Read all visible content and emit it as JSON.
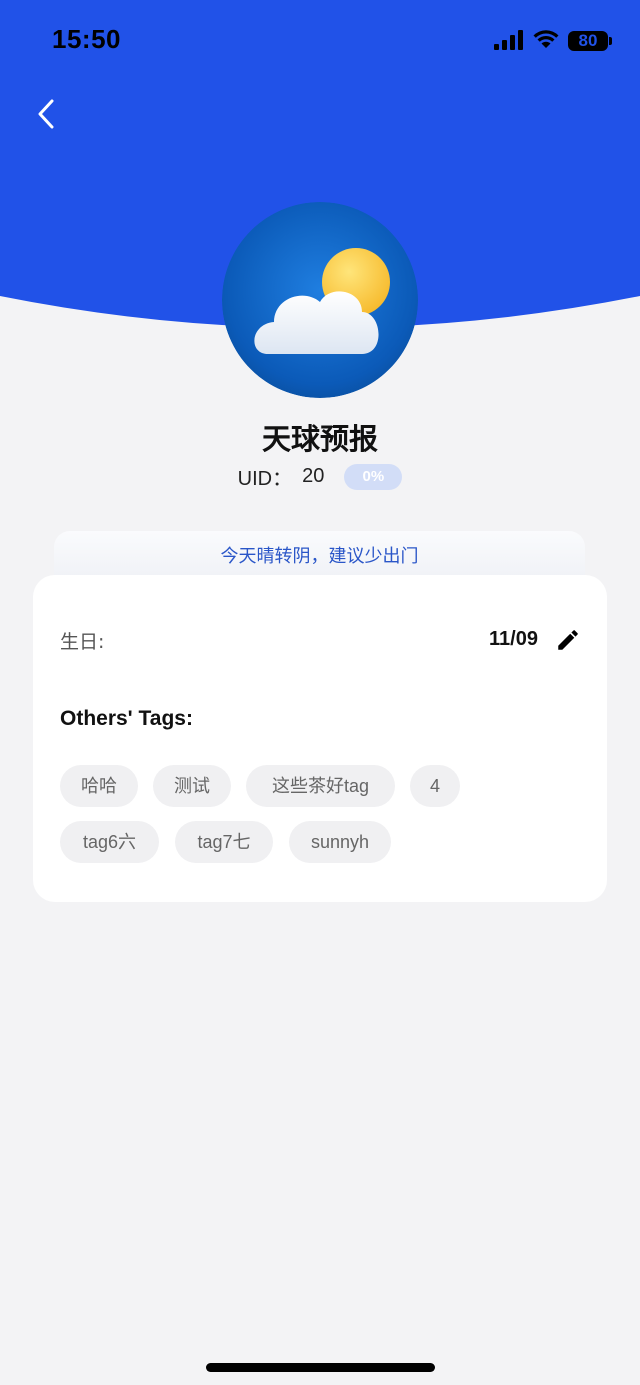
{
  "status_bar": {
    "time": "15:50",
    "battery": "80"
  },
  "colors": {
    "header_blue": "#2152e8",
    "background": "#f3f3f5",
    "accent_text": "#2a56c8"
  },
  "icons": {
    "back": "chevron-left-icon",
    "signal": "signal-icon",
    "wifi": "wifi-icon",
    "battery": "battery-icon",
    "edit": "pencil-icon",
    "avatar": "weather-partly-cloudy-icon"
  },
  "profile": {
    "name": "天球预报",
    "uid_label": "UID：",
    "uid_value": "20",
    "progress_badge": "0%"
  },
  "weather_tip": "今天晴转阴，建议少出门",
  "info": {
    "birthday_label": "生日:",
    "birthday_value": "11/09",
    "tags_title": "Others' Tags:",
    "tags": [
      "哈哈",
      "测试",
      "这些茶好tag",
      "4",
      "tag6六",
      "tag7七",
      "sunnyh"
    ]
  }
}
